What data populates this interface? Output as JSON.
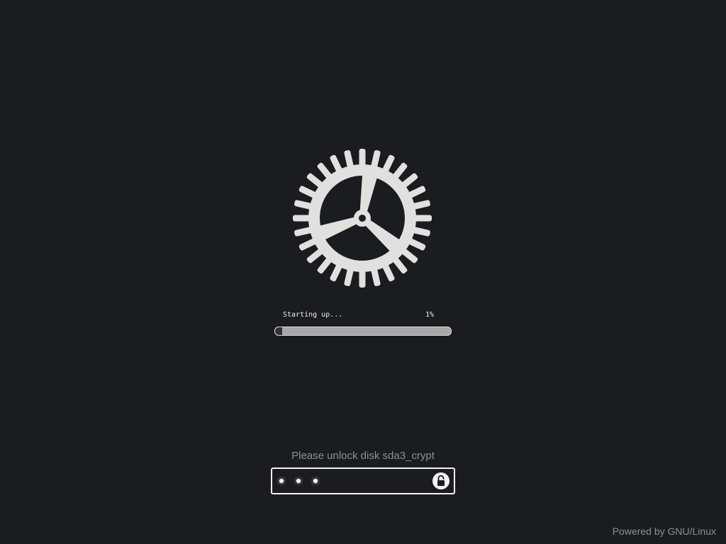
{
  "boot": {
    "status_text": "Starting up...",
    "progress_label": "1%",
    "progress_value": 0.01
  },
  "unlock": {
    "prompt": "Please unlock disk sda3_crypt",
    "password_mask_count": 3,
    "unlock_icon": "unlock-icon"
  },
  "logo": {
    "icon": "gear-icon",
    "color": "#e0e0de"
  },
  "footer": {
    "powered_by": "Powered by GNU/Linux"
  },
  "colors": {
    "background": "#1b1c20",
    "progress_track": "#a8a8a8",
    "text_muted": "#8e8f93"
  }
}
